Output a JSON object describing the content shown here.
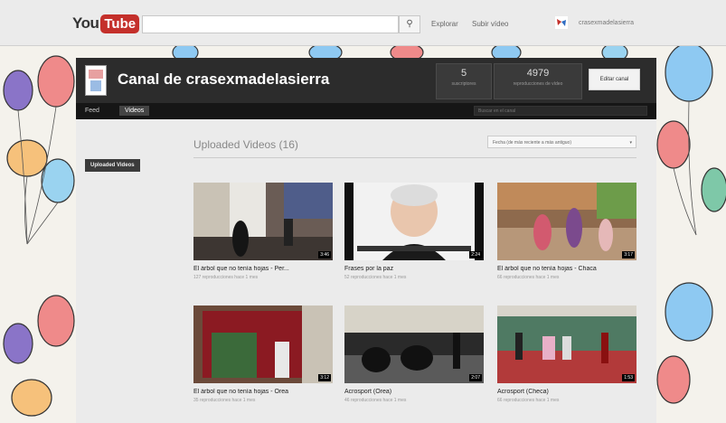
{
  "header": {
    "logo_you": "You",
    "logo_tube": "Tube",
    "search_placeholder": "",
    "links": [
      "Explorar",
      "Subir vídeo"
    ],
    "username": "crasexmadelasierra"
  },
  "channel": {
    "title": "Canal de crasexmadelasierra",
    "stats": [
      {
        "value": "5",
        "label": "suscriptores"
      },
      {
        "value": "4979",
        "label": "reproducciones de vídeo"
      }
    ],
    "edit_button": "Editar canal",
    "tabs": [
      "Feed",
      "Videos"
    ],
    "active_tab": 1,
    "search_placeholder": "Buscar en el canal"
  },
  "sidebar": {
    "uploaded_button": "Uploaded Videos"
  },
  "content": {
    "section_title": "Uploaded Videos (16)",
    "sort_label": "Fecha (de más reciente a más antiguo)",
    "videos": [
      {
        "title": "El árbol que no tenía hojas - Per...",
        "meta": "127 reproducciones hace 1 mes",
        "duration": "3:46"
      },
      {
        "title": "Frases por la paz",
        "meta": "52 reproducciones hace 1 mes",
        "duration": "2:24"
      },
      {
        "title": "El árbol que no tenía hojas - Chaca",
        "meta": "66 reproducciones hace 1 mes",
        "duration": "3:17"
      },
      {
        "title": "El árbol que no tenía hojas - Orea",
        "meta": "35 reproducciones hace 1 mes",
        "duration": "3:12"
      },
      {
        "title": "Acrosport (Orea)",
        "meta": "46 reproducciones hace 1 mes",
        "duration": "2:07"
      },
      {
        "title": "Acrosport (Checa)",
        "meta": "66 reproducciones hace 1 mes",
        "duration": "1:53"
      }
    ]
  }
}
